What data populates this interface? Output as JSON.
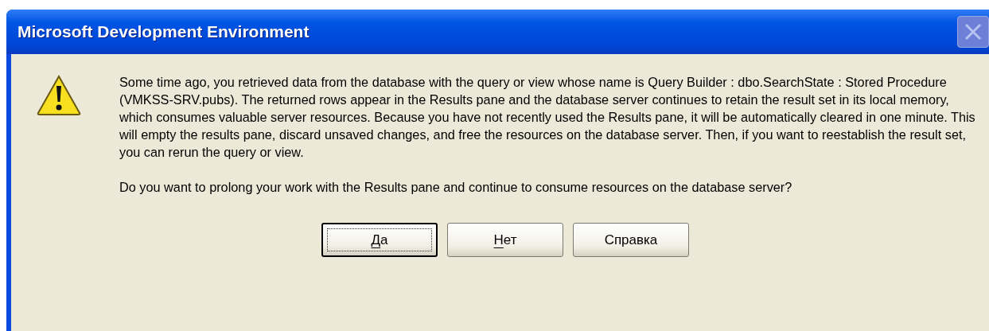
{
  "window": {
    "title": "Microsoft Development Environment"
  },
  "message": {
    "paragraphs": [
      "Some time ago, you retrieved data from the database with the query or view whose name is Query Builder : dbo.SearchState : Stored Procedure (VMKSS-SRV.pubs).  The returned rows appear in the Results pane and the database server continues to retain the result set in its local memory, which consumes valuable server resources.  Because you have not recently used the Results pane, it will be automatically cleared in one minute.  This will empty the results pane, discard unsaved changes, and free the resources on the database server.  Then, if you want to reestablish the result set, you can rerun the query or view.",
      "Do you want to prolong your work with the Results pane and continue to consume resources on the database server?"
    ]
  },
  "buttons": [
    {
      "label": "Да",
      "default": true,
      "mnemonic_underlined": true
    },
    {
      "label": "Нет",
      "default": false,
      "mnemonic_underlined": true
    },
    {
      "label": "Справка",
      "default": false,
      "mnemonic_underlined": false
    }
  ]
}
